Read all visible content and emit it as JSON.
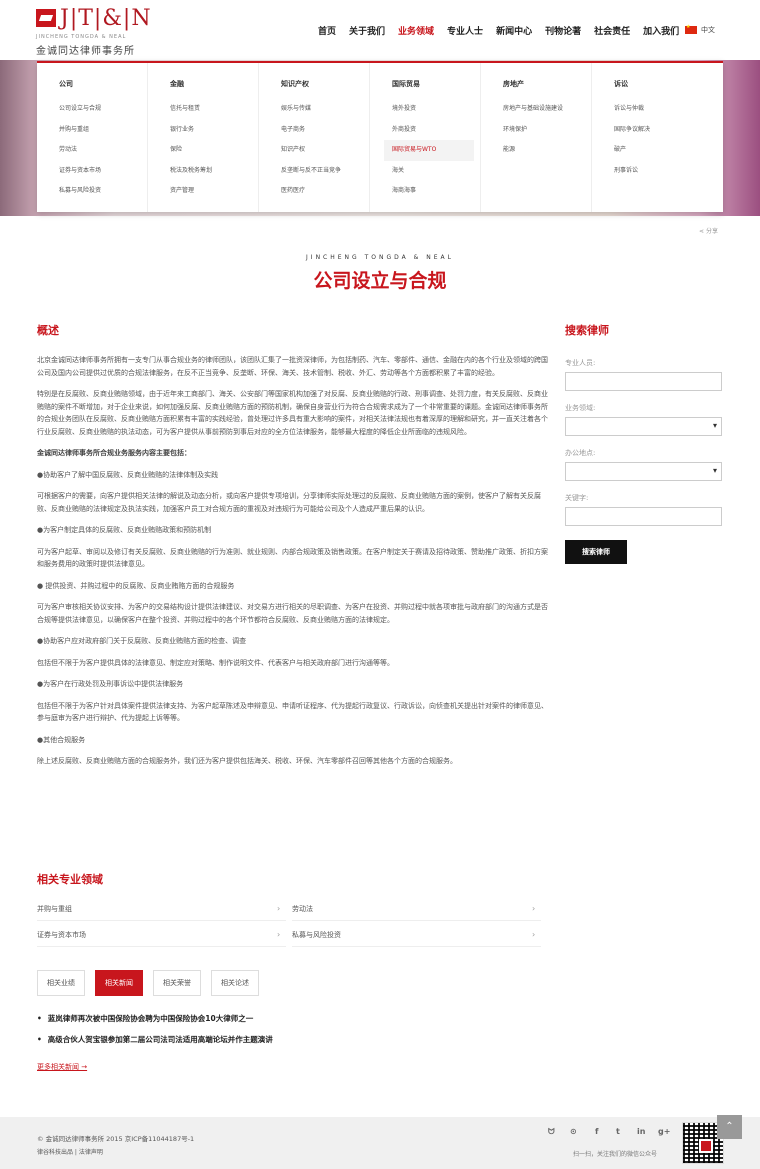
{
  "header": {
    "logo_letters": "J|T|&|N",
    "logo_en": "JINCHENG TONGDA & NEAL",
    "logo_cn": "金诚同达律师事务所",
    "nav": [
      "首页",
      "关于我们",
      "业务领域",
      "专业人士",
      "新闻中心",
      "刊物论著",
      "社会责任",
      "加入我们"
    ],
    "lang": "中文"
  },
  "mega": [
    {
      "title": "公司",
      "items": [
        "公司设立与合规",
        "并购与重组",
        "劳动法",
        "证券与资本市场",
        "私募与风险投资"
      ]
    },
    {
      "title": "金融",
      "items": [
        "信托与租赁",
        "银行业务",
        "保险",
        "税法及税务筹划",
        "资产管理"
      ]
    },
    {
      "title": "知识产权",
      "items": [
        "娱乐与传媒",
        "电子商务",
        "知识产权",
        "反垄断与反不正当竞争",
        "医药医疗"
      ]
    },
    {
      "title": "国际贸易",
      "items": [
        "境外投资",
        "外商投资",
        "国际贸易与WTO",
        "海关",
        "海商海事"
      ]
    },
    {
      "title": "房地产",
      "items": [
        "房地产与基础设施建设",
        "环境保护",
        "能源"
      ]
    },
    {
      "title": "诉讼",
      "items": [
        "诉讼与仲裁",
        "国际争议解决",
        "破产",
        "刑事诉讼"
      ]
    }
  ],
  "share": "分享",
  "page": {
    "sub": "JINCHENG TONGDA & NEAL",
    "title": "公司设立与合规",
    "overview_heading": "概述"
  },
  "content": [
    "北京金诚同达律师事务所拥有一支专门从事合规业务的律师团队，该团队汇集了一批资深律师，为包括制药、汽车、零部件、通信、金融在内的各个行业及领域的跨国公司及国内公司提供过优质的合规法律服务，在反不正当竞争、反垄断、环保、海关、技术管制、税收、外汇、劳动等各个方面都积累了丰富的经验。",
    "特别是在反腐败、反商业贿赂领域，由于近年来工商部门、海关、公安部门等国家机构加强了对反腐、反商业贿赂的行政、刑事调查、处罚力度，有关反腐败、反商业贿赂的案件不断增加，对于企业来说，如何加强反腐、反商业贿赂方面的预防机制，确保自身营业行为符合合规需求成为了一个非常重要的课题。金诚同达律师事务所的合规业务团队在反腐败、反商业贿赂方面积累有丰富的实践经验，曾处理过许多具有重大影响的案件，对相关法律法规也有着深厚的理解和研究，并一直关注着各个行业反腐败、反商业贿赂的执法动态，可为客户提供从事前预防到事后对应的全方位法律服务，能够最大程度的降低企业所面临的违规风险。",
    "金诚同达律师事务所合规业务服务内容主要包括：",
    "●协助客户了解中国反腐败、反商业贿赂的法律体制及实践",
    "可根据客户的需要，向客户提供相关法律的解说及动态分析，或向客户提供专项培训，分享律师实际处理过的反腐败、反商业贿赂方面的案例，使客户了解有关反腐败、反商业贿赂的法律规定及执法实践，加强客户员工对合规方面的重视及对违规行为可能给公司及个人造成严重后果的认识。",
    "●为客户制定具体的反腐败、反商业贿赂政策和预防机制",
    "可为客户起草、审阅以及修订有关反腐败、反商业贿赂的行为准则、就业规则、内部合规政策及销售政策。在客户制定关于赛请及招待政策、赞助推广政策、折扣方案和服务费用的政策时提供法律意见。",
    "● 提供投资、并购过程中的反腐败、反商业贿赂方面的合规服务",
    "可为客户审核相关协议安排、为客户的交易结构设计提供法律建议、对交易方进行相关的尽职调查、为客户在投资、并购过程中就各项审批与政府部门的沟通方式是否合规等提供法律意见，以确保客户在整个投资、并购过程中的各个环节都符合反腐败、反商业贿赂方面的法律规定。",
    "●协助客户应对政府部门关于反腐败、反商业贿赂方面的检查、调查",
    "包括但不限于为客户提供具体的法律意见、制定应对策略、制作说明文件、代表客户与相关政府部门进行沟通等等。",
    "●为客户在行政处罚及刑事诉讼中提供法律服务",
    "包括但不限于为客户针对具体案件提供法律支持、为客户起草陈述及申辩意见、申请听证程序、代为提起行政复议、行政诉讼，向侦查机关提出针对案件的律师意见、参与庭审为客户进行辩护、代为提起上诉等等。",
    "●其他合规服务",
    "除上述反腐败、反商业贿赂方面的合规服务外，我们还为客户提供包括海关、税收、环保、汽车零部件召回等其他各个方面的合规服务。"
  ],
  "sidebar": {
    "heading": "搜索律师",
    "f1": "专业人员:",
    "f2": "业务领域:",
    "f3": "办公地点:",
    "f4": "关键字:",
    "button": "搜索律师"
  },
  "related": {
    "heading": "相关专业领域",
    "items": [
      "并购与重组",
      "劳动法",
      "证券与资本市场",
      "私募与风险投资"
    ]
  },
  "tabs": [
    "相关业绩",
    "相关新闻",
    "相关荣誉",
    "相关论述"
  ],
  "news": [
    "蓝岚律师再次被中国保险协会聘为中国保险协会10大律师之一",
    "高级合伙人贺宝银参加第二届公司法司法适用高端论坛并作主题演讲"
  ],
  "more": "更多相关新闻 →",
  "footer": {
    "copy": "© 金诚同达律师事务所 2015 京ICP备11044187号-1",
    "links": "律谷科技出品 | 法律声明",
    "qr_text": "扫一扫，关注我们的微信公众号",
    "social": [
      "weibo-icon",
      "youku-icon",
      "facebook-icon",
      "twitter-icon",
      "linkedin-icon",
      "googleplus-icon"
    ],
    "social_glyphs": [
      "ᗢ",
      "⊙",
      "f",
      "t",
      "in",
      "g+"
    ]
  },
  "colors": {
    "accent": "#c8161d"
  }
}
